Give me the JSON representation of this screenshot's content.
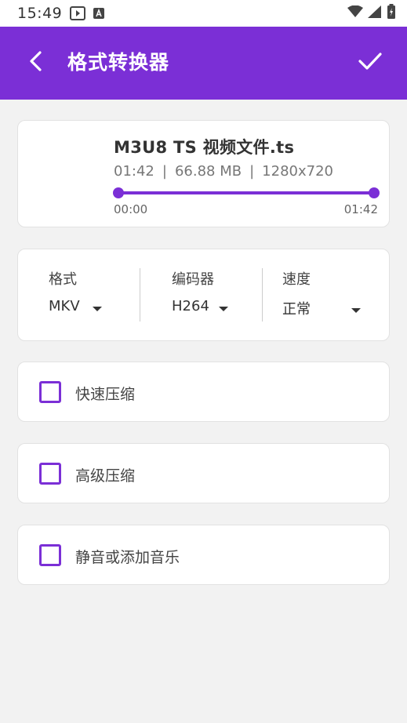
{
  "status_bar": {
    "time": "15:49"
  },
  "app_bar": {
    "title": "格式转换器",
    "accent_color": "#7b2fd6"
  },
  "video": {
    "name": "M3U8 TS 视频文件.ts",
    "duration": "01:42",
    "size": "66.88 MB",
    "resolution": "1280x720",
    "separator": "|",
    "trim_start": "00:00",
    "trim_end": "01:42"
  },
  "settings": {
    "format": {
      "label": "格式",
      "value": "MKV"
    },
    "codec": {
      "label": "编码器",
      "value": "H264"
    },
    "speed": {
      "label": "速度",
      "value": "正常"
    }
  },
  "options": [
    {
      "label": "快速压缩",
      "checked": false
    },
    {
      "label": "高级压缩",
      "checked": false
    },
    {
      "label": "静音或添加音乐",
      "checked": false
    }
  ]
}
